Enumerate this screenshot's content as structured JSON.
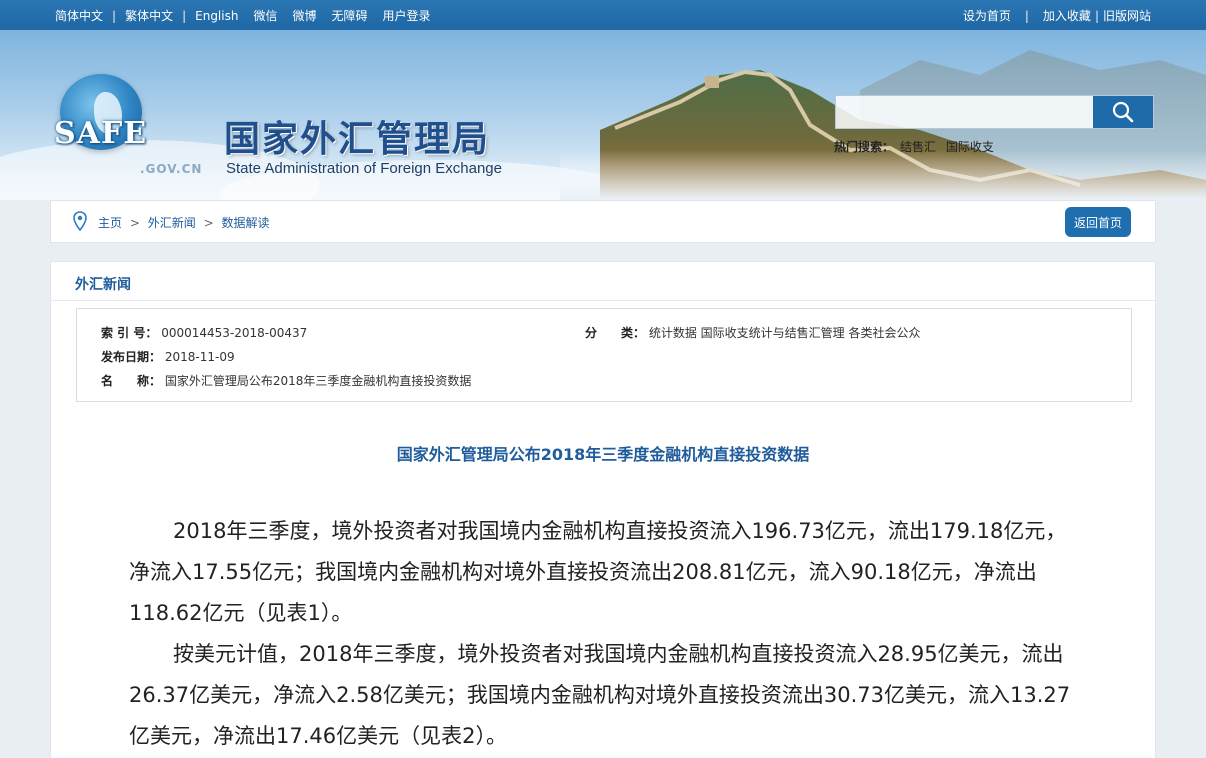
{
  "topbar": {
    "left_links": [
      "简体中文",
      "繁体中文",
      "English",
      "微信",
      "微博",
      "无障碍",
      "用户登录"
    ],
    "right_links": [
      "设为首页",
      "加入收藏",
      "旧版网站"
    ]
  },
  "header": {
    "logo_text": "SAFE",
    "logo_domain": ".GOV.CN",
    "title": "国家外汇管理局",
    "subtitle": "State Administration of Foreign Exchange",
    "search_placeholder": "",
    "hot_search_label": "热门搜索：",
    "hot_search_items": [
      "结售汇",
      "国际收支"
    ]
  },
  "breadcrumb": {
    "items": [
      "主页",
      "外汇新闻",
      "数据解读"
    ],
    "separator": ">",
    "home_button": "返回首页"
  },
  "section": {
    "title": "外汇新闻"
  },
  "meta": {
    "index_label": "索 引 号：",
    "index_value": "000014453-2018-00437",
    "date_label": "发布日期：",
    "date_value": "2018-11-09",
    "name_label": "名　　称：",
    "name_value": "国家外汇管理局公布2018年三季度金融机构直接投资数据",
    "category_label": "分　　类：",
    "category_value": "统计数据  国际收支统计与结售汇管理  各类社会公众"
  },
  "article": {
    "title": "国家外汇管理局公布2018年三季度金融机构直接投资数据",
    "paragraphs": [
      "2018年三季度，境外投资者对我国境内金融机构直接投资流入196.73亿元，流出179.18亿元，净流入17.55亿元；我国境内金融机构对境外直接投资流出208.81亿元，流入90.18亿元，净流出118.62亿元（见表1）。",
      "按美元计值，2018年三季度，境外投资者对我国境内金融机构直接投资流入28.95亿美元，流出26.37亿美元，净流入2.58亿美元；我国境内金融机构对境外直接投资流出30.73亿美元，流入13.27亿美元，净流出17.46亿美元（见表2）。"
    ]
  },
  "colors": {
    "topbar": "#1f67a5",
    "accent": "#1f5c9c",
    "button": "#1f6fb0"
  }
}
